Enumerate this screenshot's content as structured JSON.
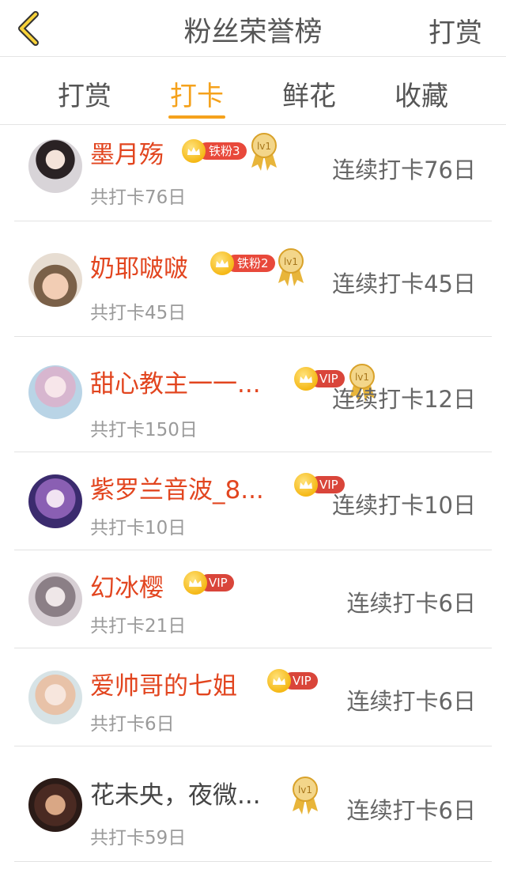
{
  "header": {
    "title": "粉丝荣誉榜",
    "action": "打赏"
  },
  "tabs": [
    {
      "label": "打赏"
    },
    {
      "label": "打卡"
    },
    {
      "label": "鲜花"
    },
    {
      "label": "收藏"
    }
  ],
  "colors": {
    "accent": "#f5a21c",
    "name_red": "#e2451f",
    "badge_red": "#e8493b"
  },
  "rows": [
    {
      "name": "墨月殇",
      "badge": "铁粉3",
      "medal": "lv1",
      "total": "共打卡76日",
      "streak": "连续打卡76日"
    },
    {
      "name": "奶耶啵啵",
      "badge": "铁粉2",
      "medal": "lv1",
      "total": "共打卡45日",
      "streak": "连续打卡45日"
    },
    {
      "name": "甜心教主一一...",
      "badge": "VIP",
      "medal": "lv1",
      "total": "共打卡150日",
      "streak": "连续打卡12日"
    },
    {
      "name": "紫罗兰音波_8...",
      "badge": "VIP",
      "total": "共打卡10日",
      "streak": "连续打卡10日"
    },
    {
      "name": "幻冰樱",
      "badge": "VIP",
      "total": "共打卡21日",
      "streak": "连续打卡6日"
    },
    {
      "name": "爱帅哥的七姐",
      "badge": "VIP",
      "total": "共打卡6日",
      "streak": "连续打卡6日"
    },
    {
      "name": "花未央，夜微...",
      "medal": "lv1",
      "total": "共打卡59日",
      "streak": "连续打卡6日"
    }
  ]
}
